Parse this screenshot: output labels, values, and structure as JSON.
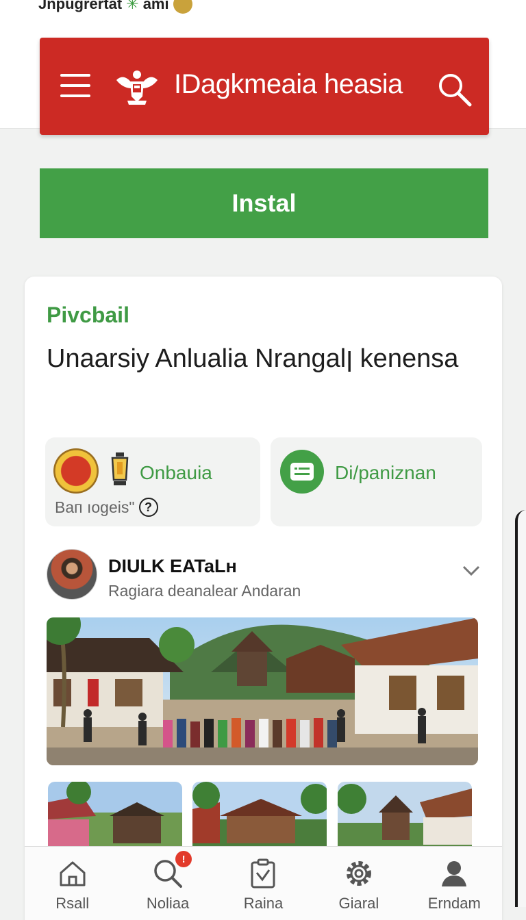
{
  "status_caption": "Jnpugrertat",
  "status_caption_suffix": "ami",
  "header": {
    "title": "IDagkmeaia heasia"
  },
  "install_button": "Instal",
  "card": {
    "label": "Pivcbail",
    "title": "Unaarsiy Anlualia Nrangalן kenensa",
    "tile_left": {
      "text": "Onbauia",
      "subtext": "Baп ıogeis\"",
      "help_glyph": "?"
    },
    "tile_right": {
      "text": "Di/paniznan"
    },
    "profile": {
      "name": "DIULK EATaLʜ",
      "subtitle": "Ragiara deanalear Andaran"
    }
  },
  "bottom_nav": {
    "items": [
      {
        "label": "Rsall",
        "icon": "home-icon"
      },
      {
        "label": "Noliaa",
        "icon": "search-icon",
        "badge": "!"
      },
      {
        "label": "Raina",
        "icon": "clipboard-check-icon"
      },
      {
        "label": "Giaral",
        "icon": "settings-gear-icon"
      },
      {
        "label": "Erndam",
        "icon": "user-icon"
      }
    ]
  },
  "colors": {
    "header_red": "#cc2a24",
    "install_green": "#43a047",
    "accent_green": "#3f9a44",
    "badge_red": "#e23a2b"
  }
}
